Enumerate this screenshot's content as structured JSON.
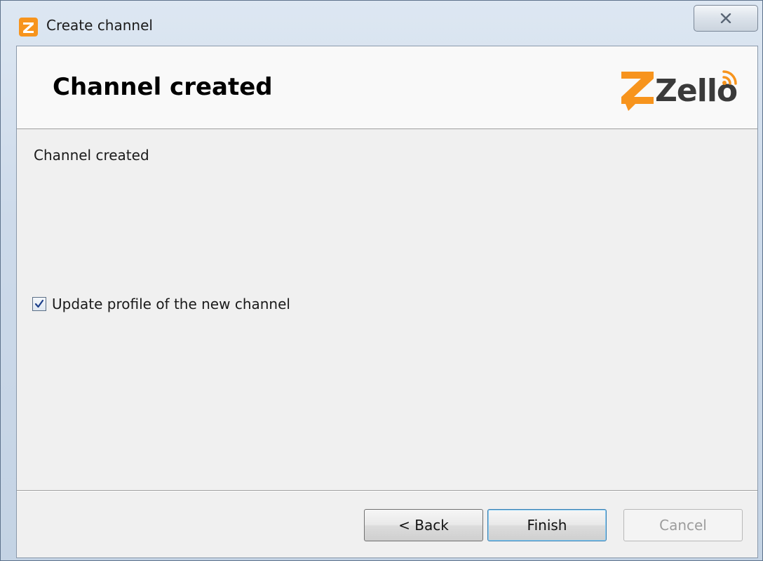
{
  "window": {
    "title": "Create channel",
    "app_icon": "zello-app-icon",
    "close_icon": "close-icon"
  },
  "header": {
    "heading": "Channel created",
    "logo_text": "Zello",
    "logo_color": "#f7941d"
  },
  "content": {
    "message": "Channel created",
    "checkbox": {
      "label": "Update profile of the new channel",
      "checked": true
    }
  },
  "buttons": {
    "back": "< Back",
    "finish": "Finish",
    "cancel": "Cancel",
    "cancel_enabled": false
  }
}
